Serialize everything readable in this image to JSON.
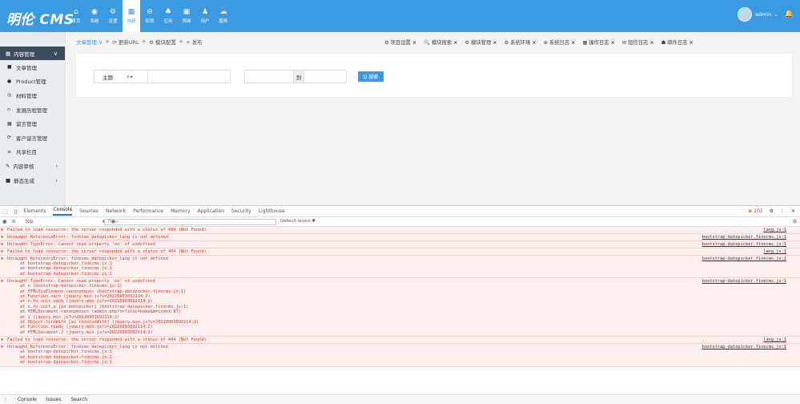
{
  "app": {
    "logo": "明伦 CMS"
  },
  "topnav": [
    {
      "icon": "⌂",
      "label": "首页"
    },
    {
      "icon": "◉",
      "label": "系统"
    },
    {
      "icon": "⚙",
      "label": "设置"
    },
    {
      "icon": "▦",
      "label": "内容",
      "active": true
    },
    {
      "icon": "⊖",
      "label": "权限"
    },
    {
      "icon": "♣",
      "label": "应用"
    },
    {
      "icon": "▣",
      "label": "界面"
    },
    {
      "icon": "♟",
      "label": "用户"
    },
    {
      "icon": "☁",
      "label": "服务"
    }
  ],
  "user": {
    "name": "admin",
    "caret": "⌄",
    "bell": "🔔"
  },
  "sidebar": {
    "head": "内容管理",
    "items": [
      {
        "icon": "■",
        "label": "文章管理"
      },
      {
        "icon": "●",
        "label": "Product管理"
      },
      {
        "icon": "◎",
        "label": "材料管理"
      },
      {
        "icon": "▫",
        "label": "发展历程管理"
      },
      {
        "icon": "▦",
        "label": "留言管理"
      },
      {
        "icon": "⟳",
        "label": "客户留言管理"
      },
      {
        "icon": "≡",
        "label": "共享栏目"
      }
    ],
    "groups": [
      {
        "icon": "✎",
        "label": "内容审核",
        "chev": "‹"
      },
      {
        "icon": "■",
        "label": "静态生成",
        "chev": "‹"
      }
    ]
  },
  "tabs_left": [
    "文章管理 ∨",
    "⟳ 更新URL",
    "⚙ 模块配置",
    "+ 发布"
  ],
  "tabs_right": [
    {
      "label": "⚙ 项目设置"
    },
    {
      "label": "🔍 模块搜索"
    },
    {
      "label": "⚙ 模块管理"
    },
    {
      "label": "⚙ 系统环境"
    },
    {
      "label": "⊕ 系统日志"
    },
    {
      "label": "▦ 操作日志"
    },
    {
      "label": "✉ 短信日志"
    },
    {
      "label": "☗ 邮件日志"
    }
  ],
  "search": {
    "field": "主题",
    "to": "到",
    "button": "Q 搜索"
  },
  "devtools": {
    "tabs": [
      "Elements",
      "Console",
      "Sources",
      "Network",
      "Performance",
      "Memory",
      "Application",
      "Security",
      "Lighthouse"
    ],
    "errors": "102",
    "context": "top",
    "filter_placeholder": "Filter",
    "levels": "Default levels ▼",
    "entries": [
      {
        "msg": "Failed to load resource: the server responded with a status of 404 (Not Found)",
        "src": "lang.js:1",
        "stack": []
      },
      {
        "msg": "Uncaught ReferenceError: finecms_datepicker_lang is not defined",
        "src": "bootstrap-datepicker.finecms.js:1",
        "stack": []
      },
      {
        "msg": "Uncaught TypeError: Cannot read property 'en' of undefined",
        "src": "bootstrap-datepicker.finecms.js:1",
        "stack": []
      },
      {
        "msg": "Failed to load resource: the server responded with a status of 404 (Not Found)",
        "src": "lang.js:1",
        "stack": []
      },
      {
        "msg": "Uncaught ReferenceError: finecms_datepicker_lang is not defined",
        "src": "bootstrap-datepicker.finecms.js:1",
        "stack": [
          "at bootstrap-datepicker.finecms.js:1",
          "at bootstrap-datepicker.finecms.js:1",
          "at bootstrap-datepicker.finecms.js:1"
        ]
      },
      {
        "msg": "Uncaught TypeError: Cannot read property 'en' of undefined",
        "src": "bootstrap-datepicker.finecms.js:1",
        "stack": [
          "at n (bootstrap-datepicker.finecms.js:1)",
          "at HTMLDivElement.<anonymous> (bootstrap-datepicker.finecms.js:1)",
          "at Function.each (jquery.min.js?v=20220903092114:2)",
          "at n.fn.init.each (jquery.min.js?v=20220903092114:2)",
          "at n.fn.init.p [as datepicker] (bootstrap-datepicker.finecms.js:1)",
          "at HTMLDocument.<anonymous> (admin.php?s=fzl&c=home&m=index:87)",
          "at i (jquery.min.js?v=20220903092114:2)",
          "at Object.fireWith [as resolveWith] (jquery.min.js?v=20220903092114:2)",
          "at Function.ready (jquery.min.js?v=20220903092114:2)",
          "at HTMLDocument.J (jquery.min.js?v=20220903092114:2)"
        ]
      },
      {
        "msg": "Failed to load resource: the server responded with a status of 404 (Not Found)",
        "src": "lang.js:1",
        "stack": []
      },
      {
        "msg": "Uncaught ReferenceError: finecms_datepicker_lang is not defined",
        "src": "bootstrap-datepicker.finecms.js:1",
        "stack": [
          "at bootstrap-datepicker.finecms.js:1",
          "at bootstrap-datepicker.finecms.js:1",
          "at bootstrap-datepicker.finecms.js:1"
        ]
      }
    ],
    "bottom": [
      "Console",
      "Issues",
      "Search"
    ]
  }
}
